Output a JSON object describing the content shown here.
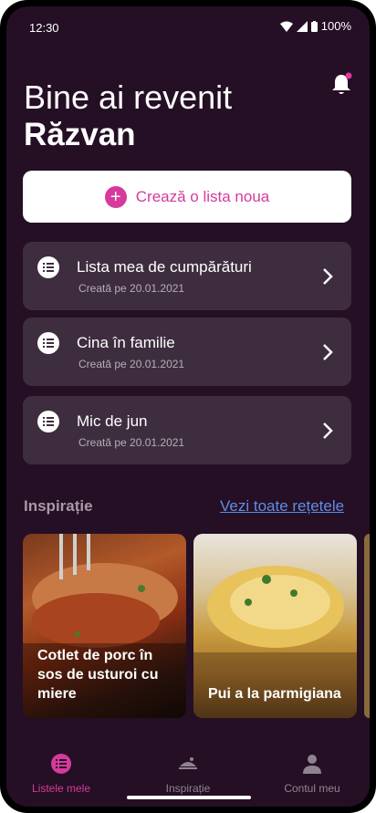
{
  "status_bar": {
    "time": "12:30",
    "battery": "100%"
  },
  "header": {
    "greeting": "Bine ai revenit",
    "user_name": "Răzvan"
  },
  "new_list_button": {
    "label": "Crează o lista noua"
  },
  "lists": [
    {
      "title": "Lista mea de cumpărături",
      "created": "Creată pe 20.01.2021"
    },
    {
      "title": "Cina în familie",
      "created": "Creată pe 20.01.2021"
    },
    {
      "title": "Mic de jun",
      "created": "Creată pe 20.01.2021"
    }
  ],
  "inspiration": {
    "title": "Inspirație",
    "see_all": "Vezi toate rețetele",
    "recipes": [
      {
        "title": "Cotlet de porc în sos de usturoi cu miere"
      },
      {
        "title": "Pui a la parmigiana"
      }
    ]
  },
  "bottom_nav": [
    {
      "label": "Listele mele",
      "icon": "list-icon",
      "active": true
    },
    {
      "label": "Inspirație",
      "icon": "food-icon",
      "active": false
    },
    {
      "label": "Contul meu",
      "icon": "user-icon",
      "active": false
    }
  ],
  "colors": {
    "background": "#250f25",
    "card": "#3e2d3e",
    "accent": "#d63a9c",
    "link": "#5d8ee6"
  }
}
